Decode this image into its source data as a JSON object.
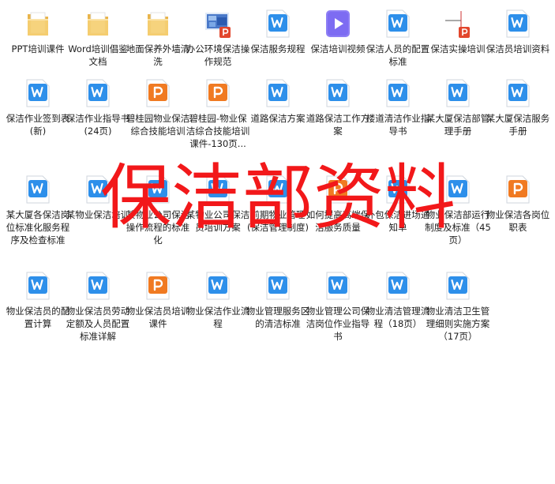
{
  "files": [
    {
      "label": "PPT培训课件",
      "icon": "folder-icon"
    },
    {
      "label": "Word培训倡鉴文档",
      "icon": "folder-icon"
    },
    {
      "label": "地面保养外墙清洗",
      "icon": "folder-icon"
    },
    {
      "label": "办公环境保洁操作规范",
      "icon": "image-ppt-icon"
    },
    {
      "label": "保洁服务规程",
      "icon": "word-icon"
    },
    {
      "label": "保洁培训视频",
      "icon": "video-icon"
    },
    {
      "label": "保洁人员的配置标准",
      "icon": "word-icon"
    },
    {
      "label": "保洁实操培训",
      "icon": "ppt-image-icon"
    },
    {
      "label": "保洁员培训资料",
      "icon": "word-icon"
    },
    {
      "label": "保洁作业签到表(新)",
      "icon": "word-icon"
    },
    {
      "label": "保洁作业指导书(24页)",
      "icon": "word-icon"
    },
    {
      "label": "碧桂园物业保洁综合技能培训",
      "icon": "ppt-icon"
    },
    {
      "label": "碧桂园-物业保洁综合技能培训课件-130页...",
      "icon": "ppt-icon"
    },
    {
      "label": "道路保洁方案",
      "icon": "word-icon"
    },
    {
      "label": "道路保洁工作方案",
      "icon": "word-icon"
    },
    {
      "label": "楼道清洁作业指导书",
      "icon": "word-icon"
    },
    {
      "label": "某大厦保洁部管理手册",
      "icon": "word-icon"
    },
    {
      "label": "某大厦保洁服务手册",
      "icon": "word-icon"
    },
    {
      "label": "某大厦各保洁岗位标准化服务程序及检查标准",
      "icon": "word-icon"
    },
    {
      "label": "某物业保洁培训",
      "icon": "word-icon"
    },
    {
      "label": "某物业公司保洁操作流程的标准化",
      "icon": "word-icon"
    },
    {
      "label": "某物业公司保洁员培训方案",
      "icon": "word-icon"
    },
    {
      "label": "前期物业管理(保洁管理制度)",
      "icon": "word-icon"
    },
    {
      "label": "如何提高高端保洁服务质量",
      "icon": "ppt-icon"
    },
    {
      "label": "外包保洁进场通知单",
      "icon": "word-icon"
    },
    {
      "label": "物业保洁部运行制度及标准（45页）",
      "icon": "word-icon"
    },
    {
      "label": "物业保洁各岗位职表",
      "icon": "ppt-icon"
    },
    {
      "label": "物业保洁员的配置计算",
      "icon": "word-icon"
    },
    {
      "label": "物业保洁员劳动定额及人员配置标准详解",
      "icon": "word-icon"
    },
    {
      "label": "物业保洁员培训课件",
      "icon": "ppt-icon"
    },
    {
      "label": "物业保洁作业流程",
      "icon": "word-icon"
    },
    {
      "label": "物业管理服务区的清洁标准",
      "icon": "word-icon"
    },
    {
      "label": "物业管理公司保洁岗位作业指导书",
      "icon": "word-icon"
    },
    {
      "label": "物业清洁管理流程（18页）",
      "icon": "word-icon"
    },
    {
      "label": "物业清洁卫生管理细则实施方案（17页）",
      "icon": "word-icon"
    }
  ],
  "watermark": "保洁部资料",
  "colors": {
    "word": "#2d8fea",
    "ppt": "#f07a22",
    "folder": "#f1c25e",
    "video": "#7d6cf2",
    "watermark": "#f2181a"
  }
}
